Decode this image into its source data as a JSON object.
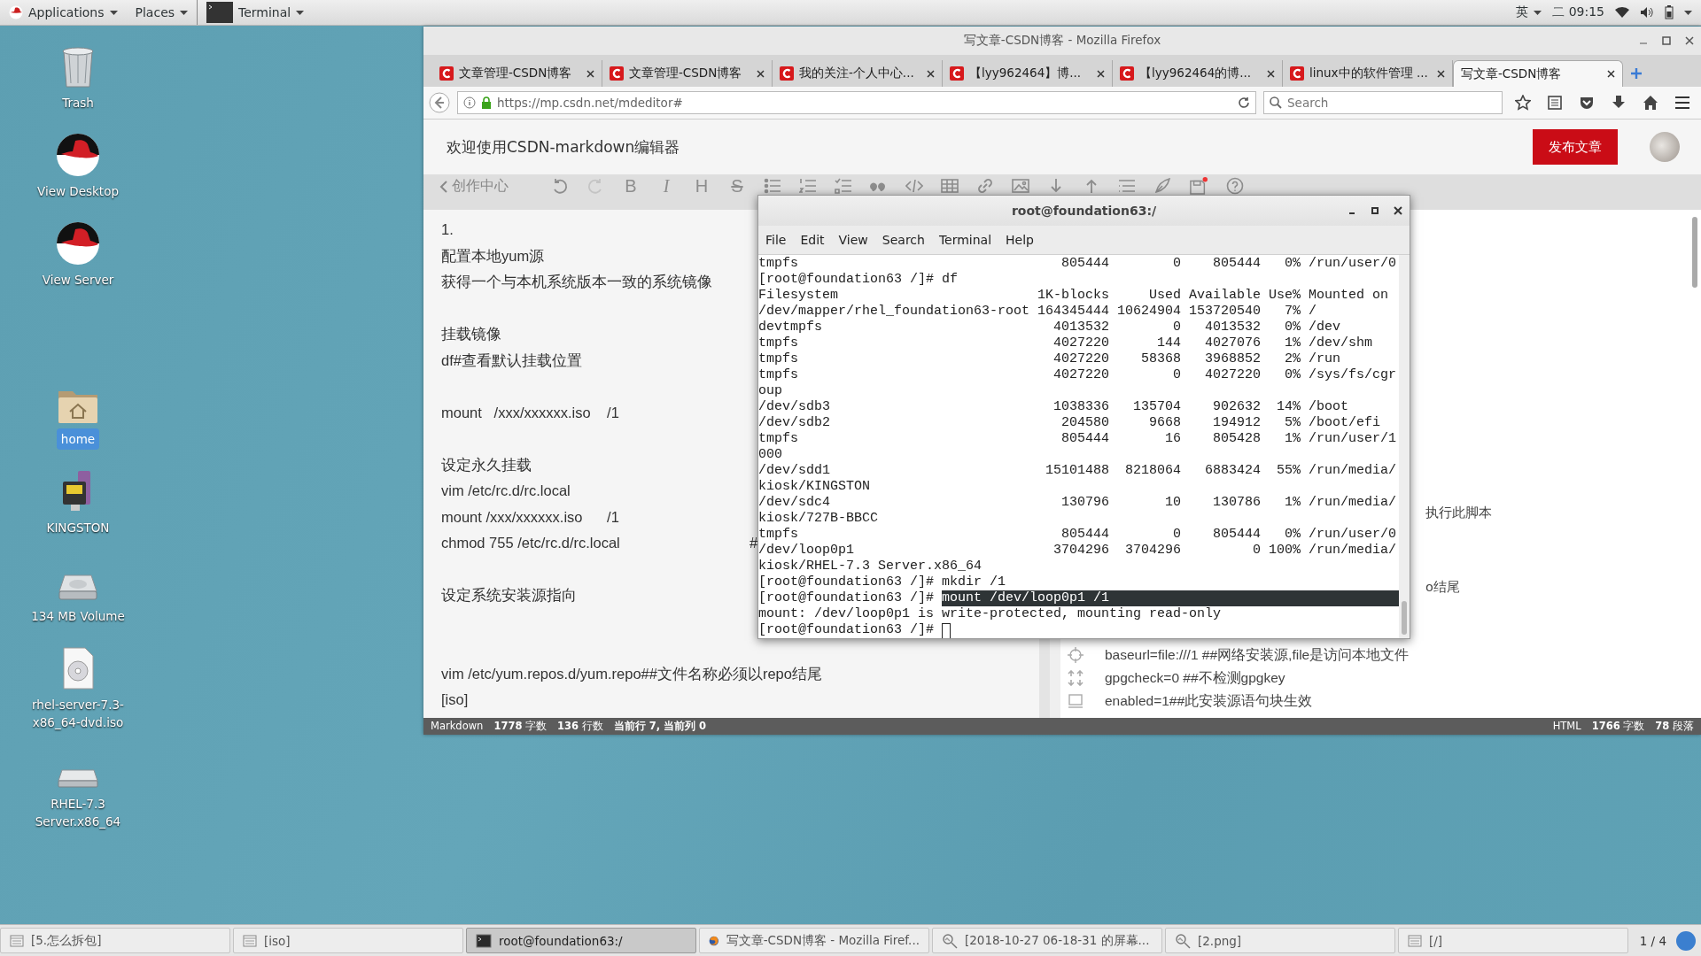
{
  "top_bar": {
    "menus": [
      {
        "label": "Applications",
        "kind": "logo"
      },
      {
        "label": "Places",
        "kind": "plain"
      },
      {
        "label": "Terminal",
        "kind": "terminal"
      }
    ],
    "input_method": "英",
    "clock": "二 09:15"
  },
  "desktop_icons": [
    {
      "label": "Trash",
      "kind": "trash",
      "selected": false
    },
    {
      "label": "View Desktop",
      "kind": "hat",
      "selected": false
    },
    {
      "label": "View Server",
      "kind": "hat",
      "selected": false
    },
    {
      "label": "home",
      "kind": "folder",
      "selected": true
    },
    {
      "label": "KINGSTON",
      "kind": "usb",
      "selected": false
    },
    {
      "label": "134 MB Volume",
      "kind": "disk",
      "selected": false
    },
    {
      "label": "rhel-server-7.3-x86_64-dvd.iso",
      "kind": "disc",
      "selected": false
    },
    {
      "label": "RHEL-7.3 Server.x86_64",
      "kind": "optical",
      "selected": false
    }
  ],
  "firefox": {
    "title": "写文章-CSDN博客 - Mozilla Firefox",
    "tabs": [
      {
        "label": "文章管理-CSDN博客",
        "icon": true,
        "selected": false
      },
      {
        "label": "文章管理-CSDN博客",
        "icon": true,
        "selected": false
      },
      {
        "label": "我的关注-个人中心...",
        "icon": true,
        "selected": false
      },
      {
        "label": "【lyy962464】博...",
        "icon": true,
        "selected": false
      },
      {
        "label": "【lyy962464的博...",
        "icon": true,
        "selected": false
      },
      {
        "label": "linux中的软件管理 ...",
        "icon": true,
        "selected": false
      },
      {
        "label": "写文章-CSDN博客",
        "icon": false,
        "selected": true
      }
    ],
    "url": "https://mp.csdn.net/mdeditor#",
    "search": {
      "placeholder": "Search"
    },
    "page": {
      "heading": "欢迎使用CSDN-markdown编辑器",
      "publish_button": "发布文章",
      "back_link": "创作中心",
      "toolbar": [
        {
          "kind": "undo"
        },
        {
          "kind": "redo"
        },
        {
          "kind": "bold",
          "label": "B"
        },
        {
          "kind": "italic",
          "label": "I"
        },
        {
          "kind": "heading",
          "label": "H"
        },
        {
          "kind": "strike",
          "label": "S"
        },
        {
          "kind": "bullets"
        },
        {
          "kind": "numbers"
        },
        {
          "kind": "tasks"
        },
        {
          "kind": "quote"
        },
        {
          "kind": "code"
        },
        {
          "kind": "table"
        },
        {
          "kind": "link"
        },
        {
          "kind": "image"
        },
        {
          "kind": "down"
        },
        {
          "kind": "up"
        },
        {
          "kind": "toc"
        },
        {
          "kind": "pen"
        },
        {
          "kind": "save"
        },
        {
          "kind": "help"
        }
      ],
      "editor_lines": [
        {
          "kind": "text",
          "text": "1."
        },
        {
          "kind": "text",
          "text": "配置本地yum源"
        },
        {
          "kind": "text",
          "text": "获得一个与本机系统版本一致的系统镜像"
        },
        {
          "kind": "blank"
        },
        {
          "kind": "text",
          "text": "挂载镜像"
        },
        {
          "kind": "text",
          "text": "df#查看默认挂载位置"
        },
        {
          "kind": "blank"
        },
        {
          "kind": "text",
          "text": "mount   /xxx/xxxxxx.iso    /1"
        },
        {
          "kind": "blank"
        },
        {
          "kind": "text",
          "text": "设定永久挂载"
        },
        {
          "kind": "text",
          "text": "vim /etc/rc.d/rc.local"
        },
        {
          "kind": "text",
          "text": "mount /xxx/xxxxxx.iso      /1"
        },
        {
          "kind": "text",
          "text": "chmod 755 /etc/rc.d/rc.local",
          "tail": "#"
        },
        {
          "kind": "blank"
        },
        {
          "kind": "text",
          "text": "设定系统安装源指向"
        },
        {
          "kind": "blank"
        },
        {
          "kind": "blank"
        },
        {
          "kind": "text",
          "text": "vim /etc/yum.repos.d/yum.repo##文件名称必须以repo结尾"
        },
        {
          "kind": "text",
          "text": "[iso]"
        }
      ],
      "preview_fragments": [
        "执行此脚本",
        "o结尾"
      ],
      "preview_lines": [
        {
          "text": "baseurl=file:///1 ##网络安装源,file是访问本地文件"
        },
        {
          "text": "gpgcheck=0 ##不检测gpgkey"
        },
        {
          "text": "enabled=1##此安装源语句块生效"
        }
      ],
      "status_left": [
        "Markdown",
        "**1778** 字数",
        "**136** 行数",
        "**当前行 7, 当前列 0**"
      ],
      "status_right": [
        "HTML",
        "**1766** 字数",
        "**78** 段落"
      ]
    }
  },
  "terminal": {
    "title": "root@foundation63:/",
    "menu": [
      "File",
      "Edit",
      "View",
      "Search",
      "Terminal",
      "Help"
    ],
    "lines": [
      {
        "kind": "output",
        "text": "tmpfs                                 805444        0    805444   0% /run/user/0"
      },
      {
        "kind": "output",
        "text": "[root@foundation63 /]# df"
      },
      {
        "kind": "output",
        "text": "Filesystem                         1K-blocks     Used Available Use% Mounted on"
      },
      {
        "kind": "output",
        "text": "/dev/mapper/rhel_foundation63-root 164345444 10624904 153720540   7% /"
      },
      {
        "kind": "output",
        "text": "devtmpfs                             4013532        0   4013532   0% /dev"
      },
      {
        "kind": "output",
        "text": "tmpfs                                4027220      144   4027076   1% /dev/shm"
      },
      {
        "kind": "output",
        "text": "tmpfs                                4027220    58368   3968852   2% /run"
      },
      {
        "kind": "output",
        "text": "tmpfs                                4027220        0   4027220   0% /sys/fs/cgr"
      },
      {
        "kind": "output",
        "text": "oup"
      },
      {
        "kind": "output",
        "text": "/dev/sdb3                            1038336   135704    902632  14% /boot"
      },
      {
        "kind": "output",
        "text": "/dev/sdb2                             204580     9668    194912   5% /boot/efi"
      },
      {
        "kind": "output",
        "text": "tmpfs                                 805444       16    805428   1% /run/user/1"
      },
      {
        "kind": "output",
        "text": "000"
      },
      {
        "kind": "output",
        "text": "/dev/sdd1                           15101488  8218064   6883424  55% /run/media/"
      },
      {
        "kind": "output",
        "text": "kiosk/KINGSTON"
      },
      {
        "kind": "output",
        "text": "/dev/sdc4                             130796       10    130786   1% /run/media/"
      },
      {
        "kind": "output",
        "text": "kiosk/727B-BBCC"
      },
      {
        "kind": "output",
        "text": "tmpfs                                 805444        0    805444   0% /run/user/0"
      },
      {
        "kind": "output",
        "text": "/dev/loop0p1                         3704296  3704296         0 100% /run/media/"
      },
      {
        "kind": "output",
        "text": "kiosk/RHEL-7.3 Server.x86_64"
      },
      {
        "kind": "output",
        "text": "[root@foundation63 /]# mkdir /1"
      },
      {
        "kind": "selection",
        "text": "[root@foundation63 /]# ",
        "selection": "mount /dev/loop0p1 /1"
      },
      {
        "kind": "output",
        "text": "mount: /dev/loop0p1 is write-protected, mounting read-only"
      },
      {
        "kind": "cursor",
        "text": "[root@foundation63 /]# "
      }
    ]
  },
  "taskbar": {
    "items": [
      {
        "label": "[5.怎么拆包]",
        "kind": "window",
        "selected": false
      },
      {
        "label": "[iso]",
        "kind": "window",
        "selected": false
      },
      {
        "label": "root@foundation63:/",
        "kind": "terminal",
        "selected": true
      },
      {
        "label": "写文章-CSDN博客 - Mozilla Firef...",
        "kind": "browser",
        "selected": false
      },
      {
        "label": "[2018-10-27 06-18-31 的屏幕...",
        "kind": "viewer",
        "selected": false
      },
      {
        "label": "[2.png]",
        "kind": "viewer",
        "selected": false
      },
      {
        "label": "[/]",
        "kind": "window",
        "selected": false
      }
    ],
    "pager": "1 / 4"
  }
}
